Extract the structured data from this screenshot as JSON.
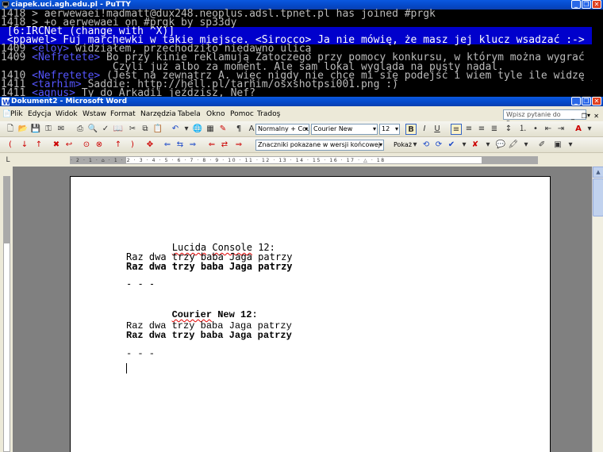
{
  "putty": {
    "title": "ciapek.uci.agh.edu.pl - PuTTY",
    "lines": [
      "1418 > aerwewaei!madmatt@dux248.neoplus.adsl.tpnet.pl has joined #prgk",
      "1418 > +o aerwewaei on #prgk by sp33dy",
      " [6:IRCNet (change with ^X)]",
      " <ppawel> Fuj marchewki w takie miejsce. <Sirocco> Ja nie mówię, że masz jej klucz wsadzać :->",
      "1409 <eloy> widziałem, przechodziło niedawno ulicą",
      "1409 <Nefretete> Bo przy kinie reklamują Zatoczego przy pomocy konkursu, w którym można wygrać kolację suszi.",
      "                  Czyli już albo za moment. Ale sam lokal wygląda na pusty nadal.",
      "1410 <Nefretete> (Jest na zewnątrz A. więc nigdy nie chce mi się podejść i wiem tyle ile widzę jadąc ulicą.)",
      "1411 <tarhim> Saddie: http://hell.pl/tarhim/osxshotpsi001.png :)",
      "1411 <agnus> Ty do Arkadii jeździsz, Nef?"
    ]
  },
  "word": {
    "title": "Dokument2 - Microsoft Word",
    "menu": [
      "Plik",
      "Edycja",
      "Widok",
      "Wstaw",
      "Format",
      "Narzędzia",
      "Tabela",
      "Okno",
      "Pomoc",
      "Tradoş"
    ],
    "help_placeholder": "Wpisz pytanie do Pomocy",
    "style_value": "Normalny + Cou",
    "font_value": "Courier New",
    "size_value": "12",
    "markup_value": "Znaczniki pokazane w wersji końcowej",
    "show_label": "Pokaż",
    "ruler_text": "· 2 · 1 · ⌂ · 1 · 2 · 3 · 4 · 5 · 6 · 7 · 8 · 9 · 10 · 11 · 12 · 13 · 14 · 15 · 16 · 17 · △ · 18",
    "document": {
      "lucida_heading_a": "Lucida",
      "lucida_heading_b": "Console",
      "lucida_heading_c": " 12:",
      "lucida_regular": "Raz dwa trzy baba Jaga patrzy",
      "lucida_bold": "Raz dwa trzy baba Jaga patrzy",
      "sep1": "- - -",
      "courier_heading_a": "Courier",
      "courier_heading_b": " New 12:",
      "courier_regular": "Raz dwa trzy baba Jaga patrzy",
      "courier_bold": "Raz dwa trzy baba Jaga patrzy",
      "sep2": "- - -"
    }
  },
  "colors": {
    "selection_bg": "#0000cc",
    "nick_color": "#5555ff",
    "titlebar": "#0548c8"
  }
}
